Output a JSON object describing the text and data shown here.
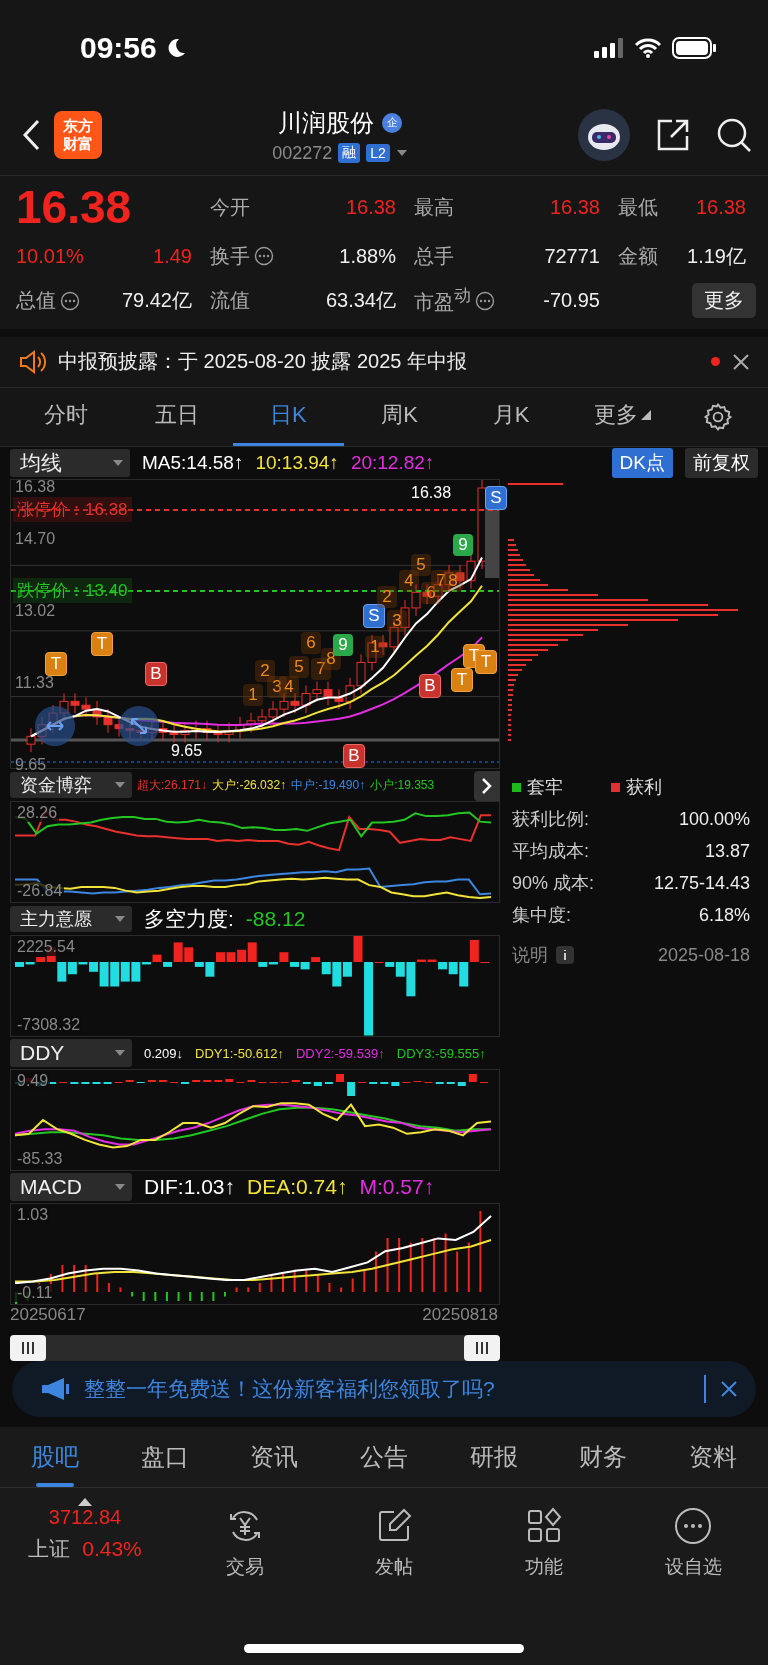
{
  "status_bar": {
    "time": "09:56"
  },
  "header": {
    "logo_lines": [
      "东方",
      "财富"
    ],
    "title": "川润股份",
    "title_badge": "企",
    "code": "002272",
    "tags": [
      "融",
      "L2"
    ]
  },
  "quote": {
    "price": "16.38",
    "change_pct": "10.01%",
    "change": "1.49",
    "stats": [
      {
        "label": "今开",
        "value": "16.38",
        "up": true,
        "info": false
      },
      {
        "label": "最高",
        "value": "16.38",
        "up": true,
        "info": false
      },
      {
        "label": "最低",
        "value": "16.38",
        "up": true,
        "info": false
      },
      {
        "label": "换手",
        "value": "1.88%",
        "up": false,
        "info": true
      },
      {
        "label": "总手",
        "value": "72771",
        "up": false,
        "info": false
      },
      {
        "label": "金额",
        "value": "1.19亿",
        "up": false,
        "info": false
      },
      {
        "label": "总值",
        "value": "79.42亿",
        "up": false,
        "info": true
      },
      {
        "label": "流值",
        "value": "63.34亿",
        "up": false,
        "info": false
      },
      {
        "label": "市盈$^{动}$",
        "value": "-70.95",
        "up": false,
        "info": true
      }
    ],
    "more_button": "更多"
  },
  "notice": {
    "text": "中报预披露：于 2025-08-20 披露 2025 年中报",
    "unread": true
  },
  "period_tabs": [
    {
      "label": "分时",
      "selected": false
    },
    {
      "label": "五日",
      "selected": false
    },
    {
      "label": "日K",
      "selected": true
    },
    {
      "label": "周K",
      "selected": false
    },
    {
      "label": "月K",
      "selected": false
    },
    {
      "label": "更多",
      "selected": false,
      "dropdown": true
    }
  ],
  "chart_toolbar": {
    "indicator": "均线",
    "readings": [
      {
        "text": "MA5:14.58↑",
        "color": "#ffffff"
      },
      {
        "text": "10:13.94↑",
        "color": "#f2e33a"
      },
      {
        "text": "20:12.82↑",
        "color": "#e22ee0"
      }
    ],
    "buttons": [
      {
        "label": "DK点",
        "selected": true
      },
      {
        "label": "前复权",
        "selected": false
      }
    ]
  },
  "kline": {
    "yticks": [
      "16.38",
      "14.70",
      "13.02",
      "11.33",
      "9.65"
    ],
    "limits": [
      {
        "kind": "upper",
        "label": "涨停价：16.38"
      },
      {
        "kind": "lower",
        "label": "跌停价：13.40"
      }
    ],
    "price_tag": "16.38",
    "low_label": "9.65",
    "markers": [
      {
        "label": "T",
        "kind": "t"
      },
      {
        "label": "T",
        "kind": "t"
      },
      {
        "label": "B",
        "kind": "b"
      },
      {
        "label": "1",
        "kind": "count"
      },
      {
        "label": "2",
        "kind": "count"
      },
      {
        "label": "3",
        "kind": "count"
      },
      {
        "label": "4",
        "kind": "count"
      },
      {
        "label": "5",
        "kind": "count"
      },
      {
        "label": "6",
        "kind": "count"
      },
      {
        "label": "7",
        "kind": "count"
      },
      {
        "label": "8",
        "kind": "count"
      },
      {
        "label": "9",
        "kind": "nine"
      },
      {
        "label": "S",
        "kind": "s"
      },
      {
        "label": "1",
        "kind": "count"
      },
      {
        "label": "2",
        "kind": "count"
      },
      {
        "label": "3",
        "kind": "count"
      },
      {
        "label": "4",
        "kind": "count"
      },
      {
        "label": "5",
        "kind": "count"
      },
      {
        "label": "6",
        "kind": "count"
      },
      {
        "label": "7",
        "kind": "count"
      },
      {
        "label": "8",
        "kind": "count"
      },
      {
        "label": "9",
        "kind": "nine"
      },
      {
        "label": "S",
        "kind": "s"
      },
      {
        "label": "B",
        "kind": "b"
      },
      {
        "label": "T",
        "kind": "t"
      },
      {
        "label": "T",
        "kind": "t"
      },
      {
        "label": "T",
        "kind": "t"
      },
      {
        "label": "B",
        "kind": "b"
      }
    ]
  },
  "panels": [
    {
      "kind": "flows",
      "name": "资金博弈",
      "expand": true,
      "readings": [
        {
          "text": "超大:26.171↓",
          "color": "#e8312c"
        },
        {
          "text": "大户:-26.032↑",
          "color": "#f2e33a"
        },
        {
          "text": "中户:-19.490↑",
          "color": "#3d86e0"
        },
        {
          "text": "小户:19.353",
          "color": "#23c623"
        }
      ],
      "yticks": [
        "28.26",
        "-26.84"
      ]
    },
    {
      "kind": "bars",
      "name": "主力意愿",
      "expand": false,
      "readings": [
        {
          "text": "多空力度:",
          "color": "#ffffff"
        },
        {
          "text": "-88.12",
          "color": "#23c623"
        }
      ],
      "yticks": [
        "2225.54",
        "-7308.32"
      ]
    },
    {
      "kind": "ddy",
      "name": "DDY",
      "expand": false,
      "readings": [
        {
          "text": "0.209↓",
          "color": "#ffffff"
        },
        {
          "text": "DDY1:-50.612↑",
          "color": "#f2e33a"
        },
        {
          "text": "DDY2:-59.539↑",
          "color": "#e22ee0"
        },
        {
          "text": "DDY3:-59.555↑",
          "color": "#23c623"
        }
      ],
      "yticks": [
        "9.49",
        "-85.33"
      ]
    },
    {
      "kind": "macd",
      "name": "MACD",
      "expand": false,
      "readings": [
        {
          "text": "DIF:1.03↑",
          "color": "#ffffff"
        },
        {
          "text": "DEA:0.74↑",
          "color": "#f2e33a"
        },
        {
          "text": "M:0.57↑",
          "color": "#e22ee0"
        }
      ],
      "yticks": [
        "1.03",
        "-0.11"
      ]
    }
  ],
  "dates": [
    "20250617",
    "20250818"
  ],
  "chip_panel": {
    "legend": [
      {
        "label": "套牢",
        "color": "#1db91d"
      },
      {
        "label": "获利",
        "color": "#e0312e"
      }
    ],
    "rows": [
      {
        "label": "获利比例:",
        "value": "100.00%"
      },
      {
        "label": "平均成本:",
        "value": "13.87"
      },
      {
        "label": "90% 成本:",
        "value": "12.75-14.43"
      },
      {
        "label": "集中度:",
        "value": "6.18%"
      }
    ],
    "note": "说明",
    "date": "2025-08-18"
  },
  "banner": {
    "text": "整整一年免费送！这份新客福利您领取了吗?"
  },
  "bottom_tabs": [
    {
      "label": "股吧",
      "selected": true
    },
    {
      "label": "盘口",
      "selected": false
    },
    {
      "label": "资讯",
      "selected": false
    },
    {
      "label": "公告",
      "selected": false
    },
    {
      "label": "研报",
      "selected": false
    },
    {
      "label": "财务",
      "selected": false
    },
    {
      "label": "资料",
      "selected": false
    }
  ],
  "bottom_bar": {
    "index": {
      "value": "3712.84",
      "name": "上证",
      "pct": "0.43%"
    },
    "actions": [
      {
        "kind": "trade",
        "label": "交易"
      },
      {
        "kind": "post",
        "label": "发帖"
      },
      {
        "kind": "feature",
        "label": "功能"
      },
      {
        "kind": "watch",
        "label": "设自选"
      }
    ]
  }
}
